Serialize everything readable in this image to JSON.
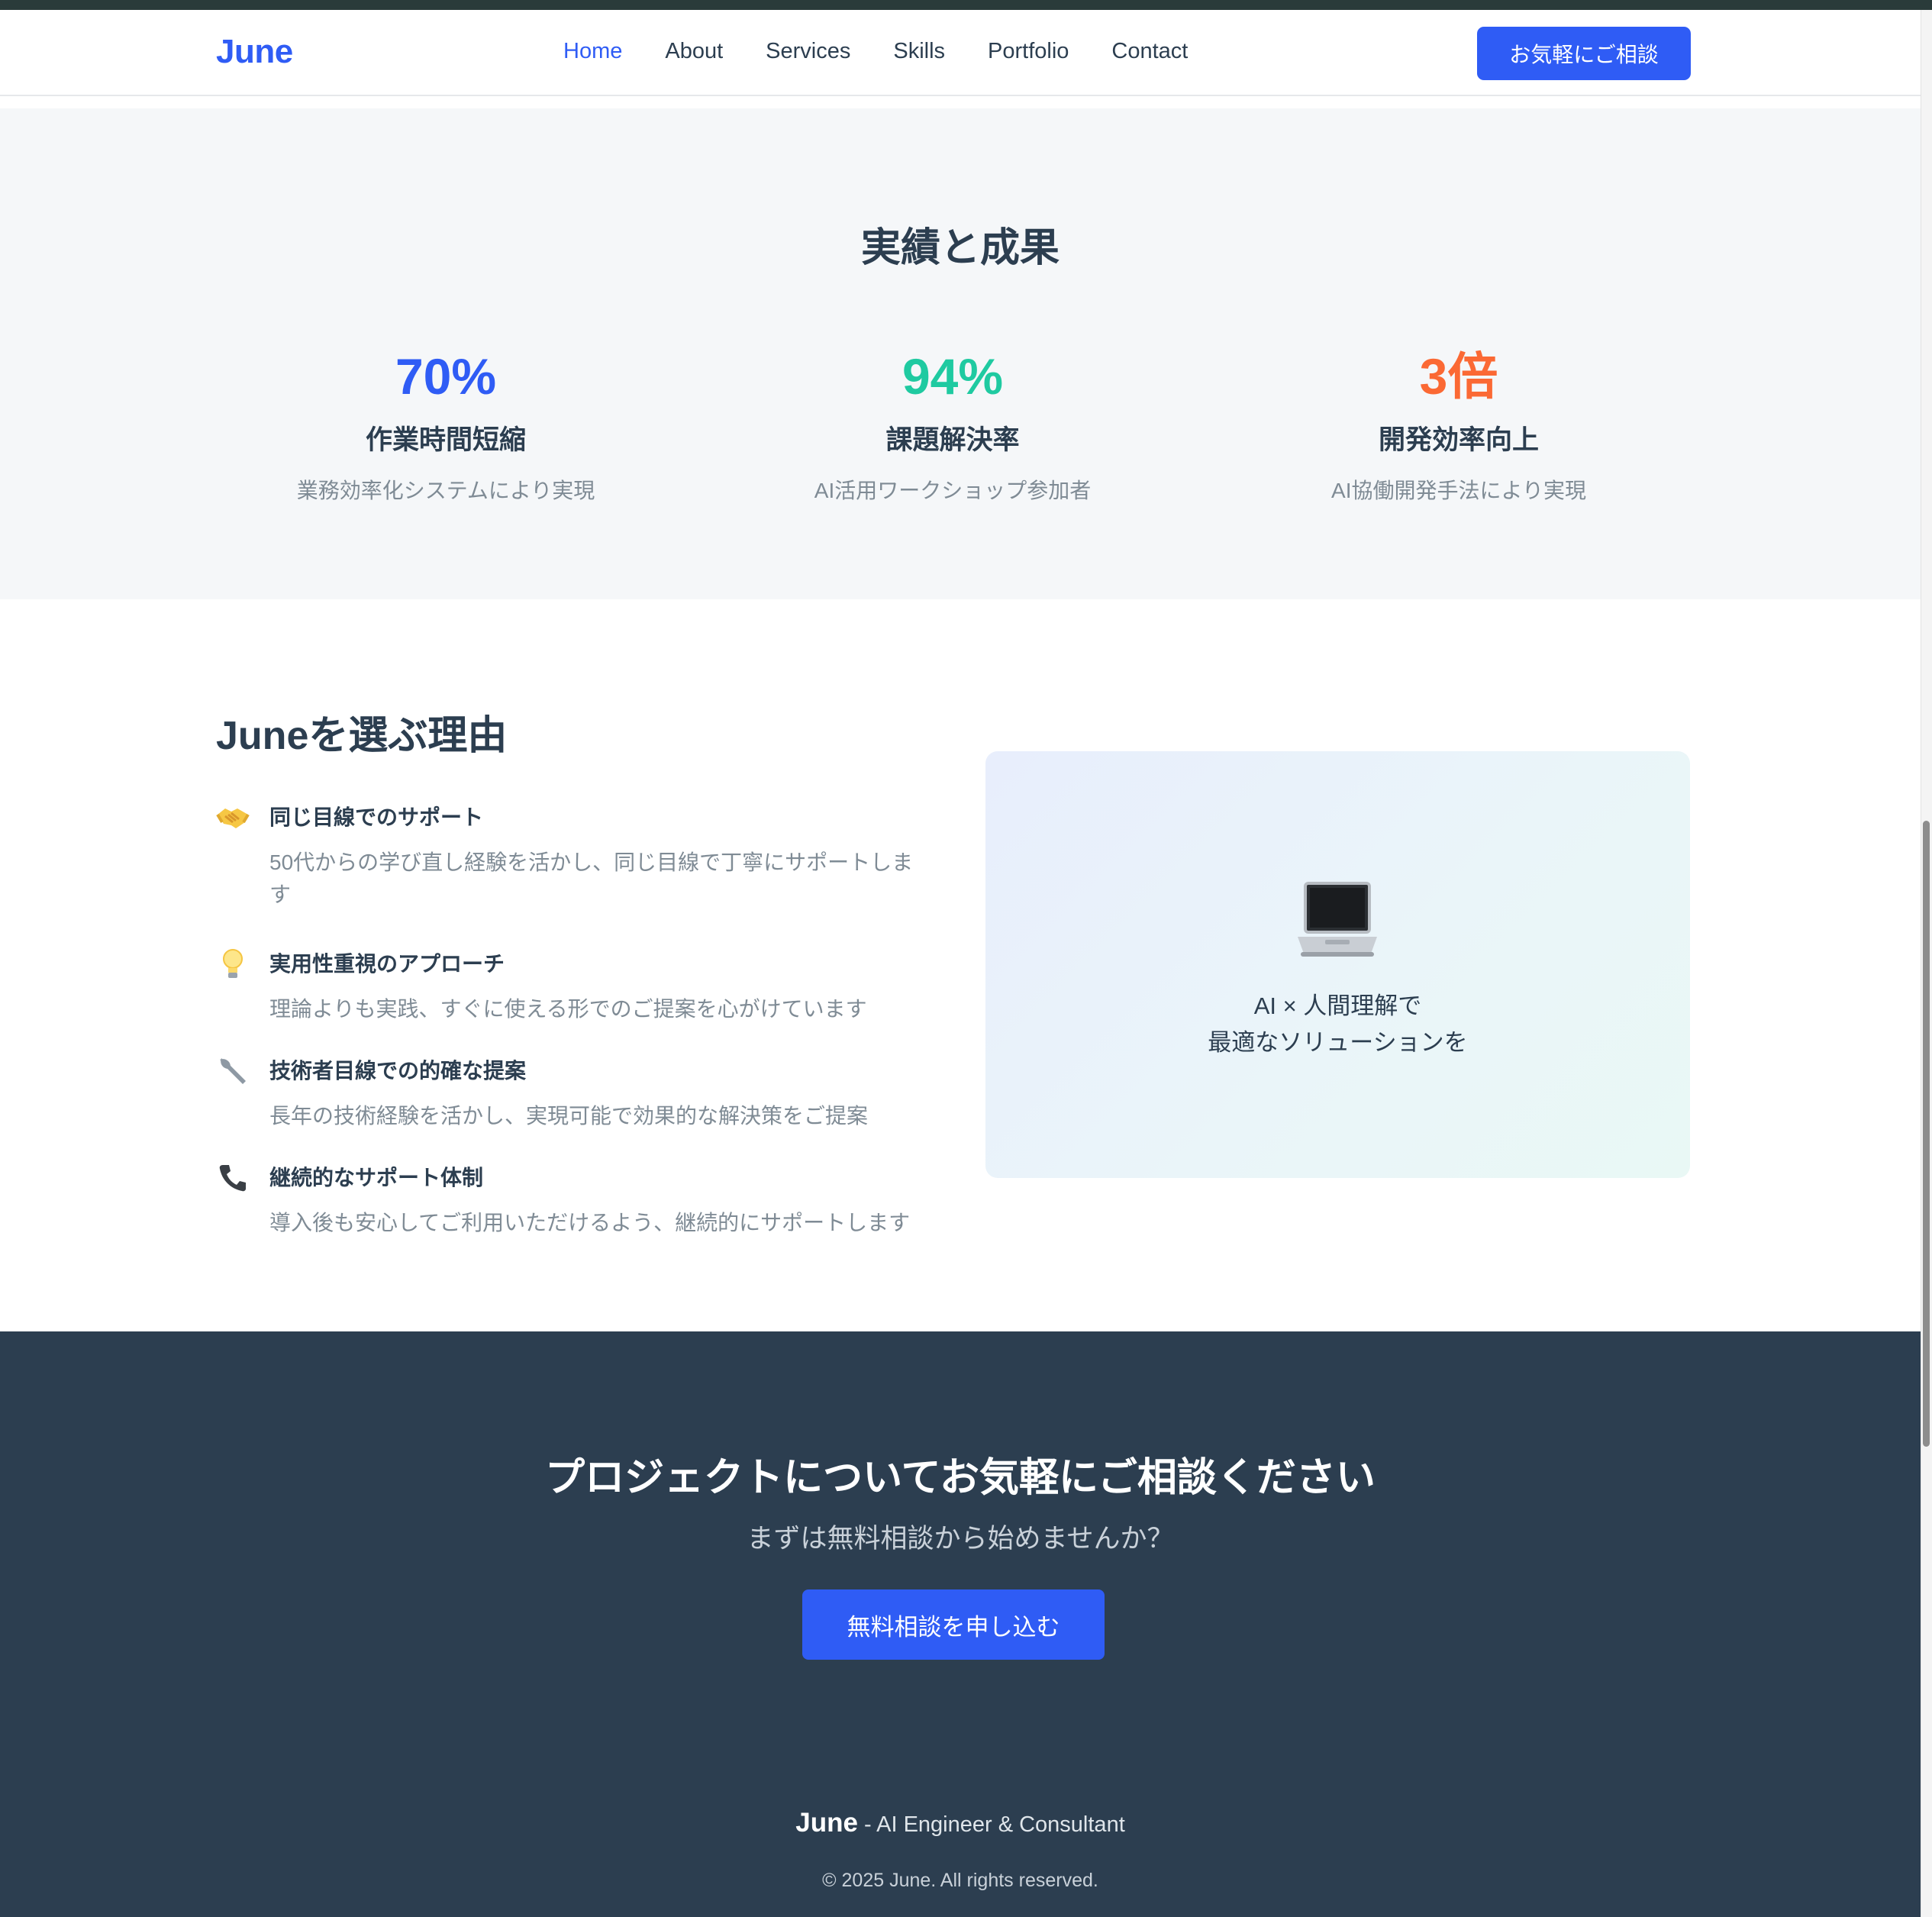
{
  "header": {
    "logo": "June",
    "nav": [
      {
        "label": "Home",
        "active": true
      },
      {
        "label": "About",
        "active": false
      },
      {
        "label": "Services",
        "active": false
      },
      {
        "label": "Skills",
        "active": false
      },
      {
        "label": "Portfolio",
        "active": false
      },
      {
        "label": "Contact",
        "active": false
      }
    ],
    "cta_label": "お気軽にご相談"
  },
  "stats": {
    "title": "実績と成果",
    "items": [
      {
        "value": "70%",
        "label": "作業時間短縮",
        "desc": "業務効率化システムにより実現",
        "color": "#2f5cf5"
      },
      {
        "value": "94%",
        "label": "課題解決率",
        "desc": "AI活用ワークショップ参加者",
        "color": "#1fcaa1"
      },
      {
        "value": "3倍",
        "label": "開発効率向上",
        "desc": "AI協働開発手法により実現",
        "color": "#fb6934"
      }
    ]
  },
  "why": {
    "title": "Juneを選ぶ理由",
    "reasons": [
      {
        "icon": "handshake-icon",
        "title": "同じ目線でのサポート",
        "desc": "50代からの学び直し経験を活かし、同じ目線で丁寧にサポートします"
      },
      {
        "icon": "lightbulb-icon",
        "title": "実用性重視のアプローチ",
        "desc": "理論よりも実践、すぐに使える形でのご提案を心がけています"
      },
      {
        "icon": "wrench-icon",
        "title": "技術者目線での的確な提案",
        "desc": "長年の技術経験を活かし、実現可能で効果的な解決策をご提案"
      },
      {
        "icon": "phone-icon",
        "title": "継続的なサポート体制",
        "desc": "導入後も安心してご利用いただけるよう、継続的にサポートします"
      }
    ],
    "visual": {
      "icon": "laptop-icon",
      "line1": "AI × 人間理解で",
      "line2": "最適なソリューションを"
    }
  },
  "cta": {
    "title": "プロジェクトについてお気軽にご相談ください",
    "subtitle": "まずは無料相談から始めませんか？",
    "button": "無料相談を申し込む"
  },
  "footer": {
    "brand": "June",
    "tagline": " - AI Engineer & Consultant",
    "copyright": "© 2025 June. All rights reserved."
  }
}
